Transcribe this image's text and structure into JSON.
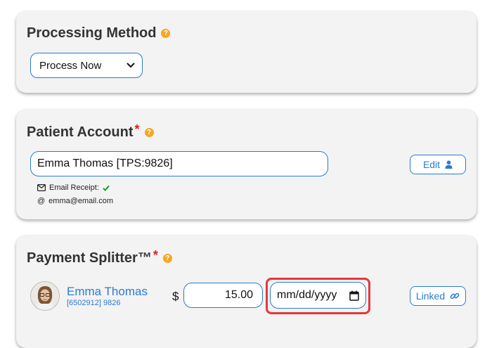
{
  "processing": {
    "title": "Processing Method",
    "help": "?",
    "select_value": "Process Now"
  },
  "patient": {
    "title": "Patient Account",
    "required": "*",
    "help": "?",
    "account_value": "Emma Thomas [TPS:9826]",
    "edit_label": "Edit",
    "email_receipt_label": "Email Receipt:",
    "email": "emma@email.com"
  },
  "splitter": {
    "title": "Payment Splitter™",
    "required": "*",
    "help": "?",
    "payee_name": "Emma Thomas",
    "payee_id": "[6502912] 9826",
    "currency": "$",
    "amount": "15.00",
    "date_placeholder": "mm/dd/yyyy",
    "linked_label": "Linked"
  },
  "colors": {
    "accent": "#2a7bd1",
    "help": "#f5a623",
    "required": "#e02020",
    "highlight": "#e5383b",
    "check": "#1a9b2a"
  },
  "icons": [
    "help-icon",
    "chevron-down-icon",
    "user-icon",
    "envelope-icon",
    "checkmark-icon",
    "at-icon",
    "calendar-icon",
    "link-icon"
  ]
}
